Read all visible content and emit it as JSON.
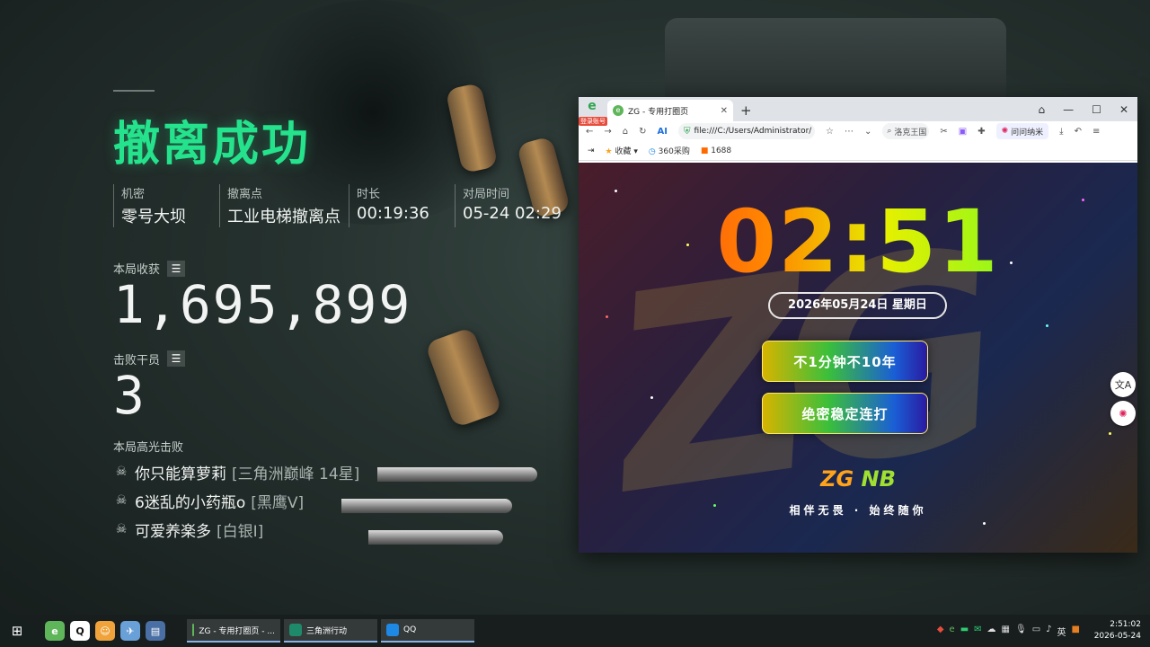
{
  "game_result": {
    "title": "撤离成功",
    "info": [
      {
        "label": "机密",
        "value": "零号大坝"
      },
      {
        "label": "撤离点",
        "value": "工业电梯撤离点"
      },
      {
        "label": "时长",
        "value": "00:19:36"
      },
      {
        "label": "对局时间",
        "value": "05-24 02:29"
      }
    ],
    "income_label": "本局收获",
    "income_value": "1,695,899",
    "defeated_label": "击败干员",
    "defeated_value": "3",
    "highlight_label": "本局高光击败",
    "kills": [
      {
        "name": "你只能算萝莉",
        "rank": "[三角洲巅峰 14星]"
      },
      {
        "name": "6迷乱的小药瓶o",
        "rank": "[黑鹰V]"
      },
      {
        "name": "可爱养楽多",
        "rank": "[白银I]"
      }
    ]
  },
  "browser": {
    "logo_badge": "登录账号",
    "tab_title": "ZG - 专用打圈页",
    "address": "file:///C:/Users/Administrator/",
    "search_text": "洛克王国",
    "ask_label": "问问纳米",
    "bookmarks": [
      "收藏",
      "360采购",
      "1688"
    ]
  },
  "page": {
    "clock": "02:51",
    "date": "2026年05月24日 星期日",
    "button1": "不1分钟不10年",
    "button2": "绝密稳定连打",
    "brand_a": "ZG",
    "brand_b": " NB",
    "slogan": "相伴无畏 · 始终随你",
    "bg_logo": "ZG"
  },
  "taskbar": {
    "tasks": [
      {
        "label": "ZG - 专用打圈页 - ...",
        "color": "#5fb65a"
      },
      {
        "label": "三角洲行动",
        "color": "#1f8a6a"
      },
      {
        "label": "QQ",
        "color": "#1e88e5"
      }
    ],
    "tray_lang": "英",
    "time": "2:51:02",
    "date": "2026-05-24"
  },
  "colors": {
    "success_green": "#24e38c",
    "clock_gradient": [
      "#ff2a1a",
      "#ff8a00",
      "#e6f000",
      "#38ff38"
    ]
  }
}
